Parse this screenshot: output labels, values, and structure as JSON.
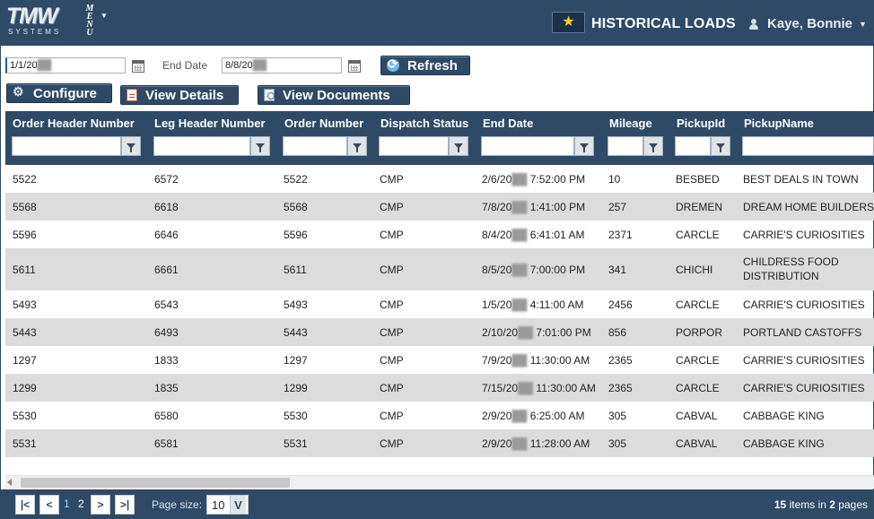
{
  "header": {
    "logo_text": "TMW",
    "logo_sub": "SYSTEMS",
    "menu_label": "MENU",
    "page_title": "HISTORICAL LOADS",
    "user_name": "Kaye, Bonnie"
  },
  "filters": {
    "start_date": "1/1/20",
    "end_label": "End Date",
    "end_date": "8/8/20",
    "refresh_label": "Refresh"
  },
  "toolbar": {
    "configure_label": "Configure",
    "details_label": "View Details",
    "documents_label": "View Documents"
  },
  "grid": {
    "columns": [
      "Order Header Number",
      "Leg Header Number",
      "Order Number",
      "Dispatch Status",
      "End Date",
      "Mileage",
      "PickupId",
      "PickupName"
    ],
    "rows": [
      {
        "ohn": "5522",
        "lhn": "6572",
        "on": "5522",
        "status": "CMP",
        "date_a": "2/6/20",
        "date_b": "7:52:00 PM",
        "mileage": "10",
        "pid": "BESBED",
        "pname": "BEST DEALS IN TOWN"
      },
      {
        "ohn": "5568",
        "lhn": "6618",
        "on": "5568",
        "status": "CMP",
        "date_a": "7/8/20",
        "date_b": "1:41:00 PM",
        "mileage": "257",
        "pid": "DREMEN",
        "pname": "DREAM HOME BUILDERS"
      },
      {
        "ohn": "5596",
        "lhn": "6646",
        "on": "5596",
        "status": "CMP",
        "date_a": "8/4/20",
        "date_b": "6:41:01 AM",
        "mileage": "2371",
        "pid": "CARCLE",
        "pname": "CARRIE'S CURIOSITIES"
      },
      {
        "ohn": "5611",
        "lhn": "6661",
        "on": "5611",
        "status": "CMP",
        "date_a": "8/5/20",
        "date_b": "7:00:00 PM",
        "mileage": "341",
        "pid": "CHICHI",
        "pname": "CHILDRESS FOOD DISTRIBUTION"
      },
      {
        "ohn": "5493",
        "lhn": "6543",
        "on": "5493",
        "status": "CMP",
        "date_a": "1/5/20",
        "date_b": "4:11:00 AM",
        "mileage": "2456",
        "pid": "CARCLE",
        "pname": "CARRIE'S CURIOSITIES"
      },
      {
        "ohn": "5443",
        "lhn": "6493",
        "on": "5443",
        "status": "CMP",
        "date_a": "2/10/20",
        "date_b": "7:01:00 PM",
        "mileage": "856",
        "pid": "PORPOR",
        "pname": "PORTLAND CASTOFFS"
      },
      {
        "ohn": "1297",
        "lhn": "1833",
        "on": "1297",
        "status": "CMP",
        "date_a": "7/9/20",
        "date_b": "11:30:00 AM",
        "mileage": "2365",
        "pid": "CARCLE",
        "pname": "CARRIE'S CURIOSITIES"
      },
      {
        "ohn": "1299",
        "lhn": "1835",
        "on": "1299",
        "status": "CMP",
        "date_a": "7/15/20",
        "date_b": "11:30:00 AM",
        "mileage": "2365",
        "pid": "CARCLE",
        "pname": "CARRIE'S CURIOSITIES"
      },
      {
        "ohn": "5530",
        "lhn": "6580",
        "on": "5530",
        "status": "CMP",
        "date_a": "2/9/20",
        "date_b": "6:25:00 AM",
        "mileage": "305",
        "pid": "CABVAL",
        "pname": "CABBAGE KING"
      },
      {
        "ohn": "5531",
        "lhn": "6581",
        "on": "5531",
        "status": "CMP",
        "date_a": "2/9/20",
        "date_b": "11:28:00 AM",
        "mileage": "305",
        "pid": "CABVAL",
        "pname": "CABBAGE KING"
      }
    ]
  },
  "pager": {
    "first": "|<",
    "prev": "<",
    "pages": [
      "1",
      "2"
    ],
    "next": ">",
    "last": ">|",
    "page_size_label": "Page size:",
    "page_size": "10",
    "dropdown": "V",
    "total_items": "15",
    "items_label": "items in",
    "total_pages": "2",
    "pages_label": "pages"
  }
}
